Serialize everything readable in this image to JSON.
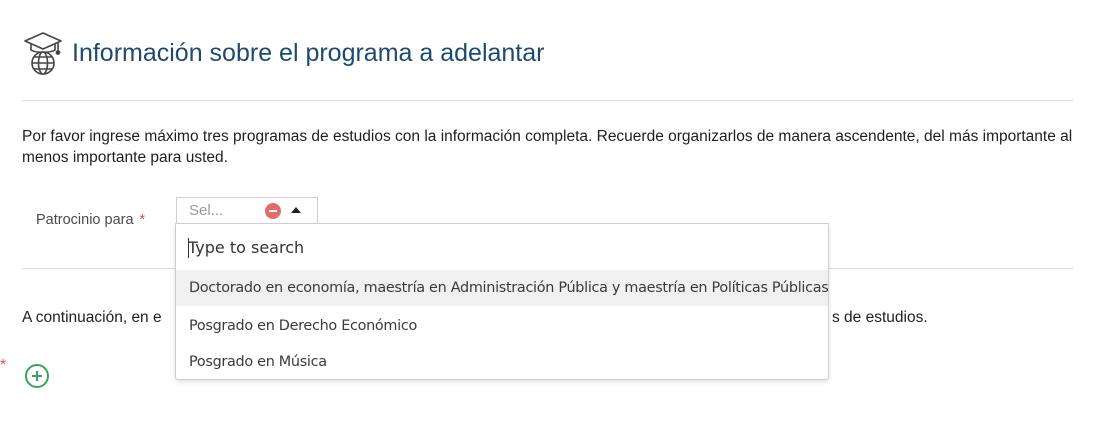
{
  "header": {
    "title": "Información sobre el programa a adelantar",
    "icon": "graduation-globe-icon"
  },
  "intro": {
    "text": "Por favor ingrese máximo tres programas de estudios con la información completa. Recuerde organizarlos de manera ascendente, del más importante al menos importante para usted."
  },
  "field": {
    "label": "Patrocinio para",
    "required_mark": "*",
    "select_placeholder": "Sel...",
    "search_placeholder": "Type to search",
    "options": [
      "Doctorado en economía, maestría en Administración Pública y maestría en Políticas Públicas",
      "Posgrado en Derecho Económico",
      "Posgrado en Música"
    ]
  },
  "continuation": {
    "visible_start": "A continuación, en e",
    "visible_end": "s de estudios."
  },
  "required_star": "*",
  "colors": {
    "title": "#1e4a6f",
    "required": "#d9534f",
    "add": "#3aa35a",
    "clear": "#e56b6b"
  }
}
